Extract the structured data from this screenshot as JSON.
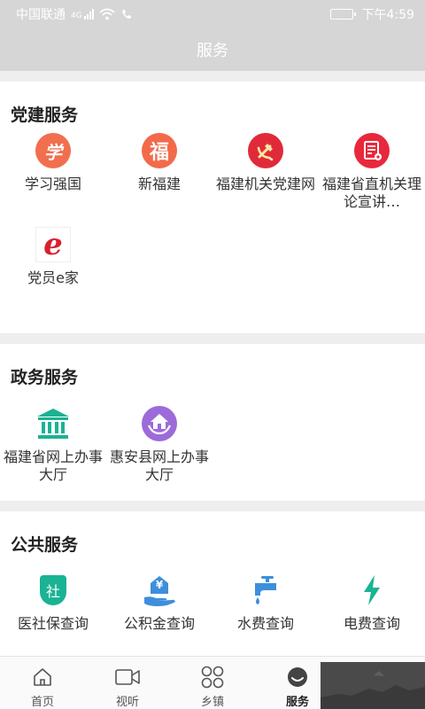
{
  "status": {
    "carrier": "中国联通",
    "network": "4G",
    "time": "下午4:59"
  },
  "header": {
    "title": "服务"
  },
  "sections": [
    {
      "title": "党建服务",
      "items": [
        {
          "label": "学习强国",
          "icon": "xuexi-qiangguo-icon"
        },
        {
          "label": "新福建",
          "icon": "fu-character-icon"
        },
        {
          "label": "福建机关党建网",
          "icon": "party-emblem-icon"
        },
        {
          "label": "福建省直机关理论宣讲…",
          "icon": "document-icon"
        },
        {
          "label": "党员e家",
          "icon": "e-logo-icon"
        }
      ]
    },
    {
      "title": "政务服务",
      "items": [
        {
          "label": "福建省网上办事大厅",
          "icon": "government-building-icon"
        },
        {
          "label": "惠安县网上办事大厅",
          "icon": "house-hands-icon"
        }
      ]
    },
    {
      "title": "公共服务",
      "items": [
        {
          "label": "医社保查询",
          "icon": "social-insurance-shield-icon"
        },
        {
          "label": "公积金查询",
          "icon": "housing-fund-hand-icon"
        },
        {
          "label": "水费查询",
          "icon": "water-faucet-icon"
        },
        {
          "label": "电费查询",
          "icon": "lightning-icon"
        }
      ]
    }
  ],
  "icon_glyphs": {
    "xuexi": "学",
    "fu": "福",
    "e": "e",
    "she": "社",
    "yen": "¥"
  },
  "tabs": [
    {
      "label": "首页",
      "icon": "home-icon"
    },
    {
      "label": "视听",
      "icon": "video-icon"
    },
    {
      "label": "乡镇",
      "icon": "grid-circles-icon"
    },
    {
      "label": "服务",
      "icon": "service-face-icon",
      "active": true
    }
  ],
  "colors": {
    "header": "#d6d6d6",
    "teal": "#1ab394",
    "purple": "#9c6bd9",
    "red": "#e02a3a",
    "orange": "#f06a4c",
    "blue": "#3d8fdc"
  }
}
